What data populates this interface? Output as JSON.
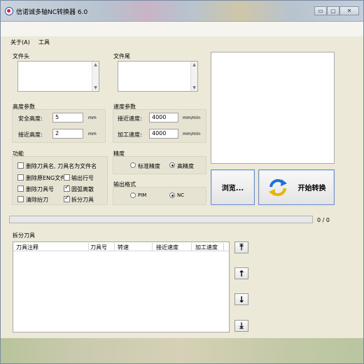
{
  "window": {
    "title": "信诺诚多轴NC转换器 6.0",
    "minimize": "▭",
    "maximize": "▢",
    "close": "✕"
  },
  "menu": {
    "about": "关于(A)",
    "tools": "工具"
  },
  "file_header": {
    "label": "文件头",
    "value": ""
  },
  "file_footer": {
    "label": "文件尾",
    "value": ""
  },
  "height_params": {
    "label": "高度参数",
    "safe_height": {
      "label": "安全高度:",
      "value": "5",
      "unit": "mm"
    },
    "approach_height": {
      "label": "接近高度:",
      "value": "2",
      "unit": "mm"
    }
  },
  "speed_params": {
    "label": "速度参数",
    "approach_speed": {
      "label": "接近速度:",
      "value": "4000",
      "unit": "mm/min"
    },
    "machining_speed": {
      "label": "加工速度:",
      "value": "4000",
      "unit": "mm/min"
    }
  },
  "functions": {
    "label": "功能",
    "options": [
      {
        "label": "删除刀具名, 刀具名为文件名",
        "checked": false
      },
      {
        "label": "删除原ENG文件",
        "checked": false
      },
      {
        "label": "输出行号",
        "checked": false
      },
      {
        "label": "删除刀具号",
        "checked": false
      },
      {
        "label": "圆弧离散",
        "checked": true
      },
      {
        "label": "清除抬刀",
        "checked": false
      },
      {
        "label": "拆分刀具",
        "checked": true
      }
    ]
  },
  "precision": {
    "label": "精度",
    "options": [
      {
        "label": "标准精度",
        "checked": false
      },
      {
        "label": "高精度",
        "checked": true
      }
    ]
  },
  "output_format": {
    "label": "输出格式",
    "options": [
      {
        "label": "PIM",
        "checked": false
      },
      {
        "label": "NC",
        "checked": true
      }
    ]
  },
  "buttons": {
    "browse": "浏览...",
    "convert": "开始转换"
  },
  "progress": {
    "text": "0 / 0",
    "fraction": 0
  },
  "split_tools": {
    "label": "拆分刀具",
    "columns": [
      "刀具注释",
      "刀具号",
      "转速",
      "接近速度",
      "加工速度"
    ],
    "rows": []
  },
  "side_buttons": {
    "top": "⤒",
    "up": "↑",
    "down": "↓",
    "bottom": "⤓"
  },
  "colors": {
    "accent": "#6f8fc7",
    "convert_icon_blue": "#1f6fd6",
    "convert_icon_yellow": "#e8b400"
  }
}
